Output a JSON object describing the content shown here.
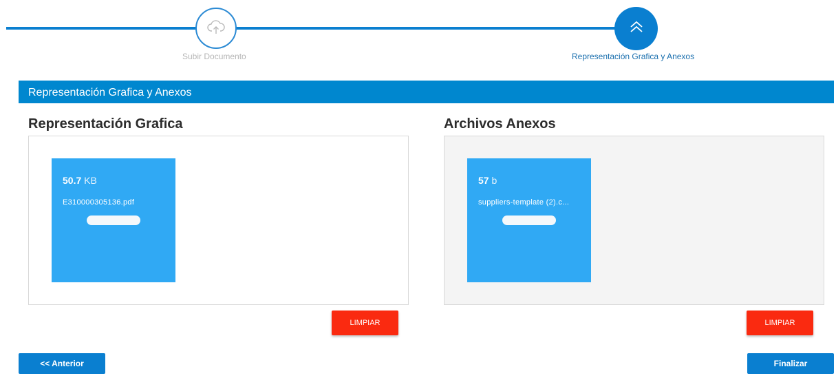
{
  "stepper": {
    "steps": [
      {
        "label": "Subir Documento",
        "icon": "cloud-upload-icon",
        "state": "completed"
      },
      {
        "label": "Representación Grafica y Anexos",
        "icon": "chevron-double-up-icon",
        "state": "active"
      }
    ]
  },
  "section": {
    "title": "Representación Grafica y Anexos"
  },
  "graphic": {
    "title": "Representación Grafica",
    "file": {
      "size_value": "50.7",
      "size_unit": "KB",
      "name": "E310000305136.pdf"
    },
    "clear_label": "LIMPIAR"
  },
  "annexes": {
    "title": "Archivos Anexos",
    "file": {
      "size_value": "57",
      "size_unit": "b",
      "name": "suppliers-template (2).c..."
    },
    "clear_label": "LIMPIAR"
  },
  "nav": {
    "prev_label": "<< Anterior",
    "finish_label": "Finalizar"
  },
  "colors": {
    "primary": "#0a7fd0",
    "header": "#0087cf",
    "file_card": "#30a9f4",
    "danger": "#fa2a10"
  }
}
